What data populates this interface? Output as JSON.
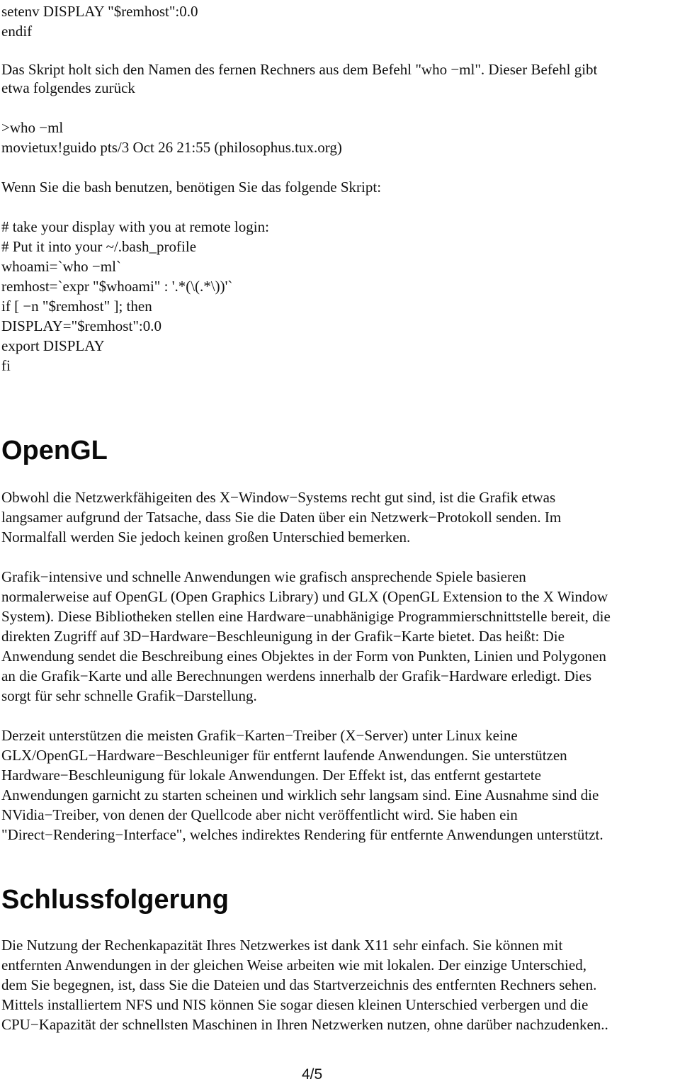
{
  "intro_code": [
    "setenv DISPLAY \"$remhost\":0.0",
    "endif"
  ],
  "intro_paragraph": [
    "Das Skript holt sich den Namen des fernen Rechners aus dem Befehl \"who −ml\". Dieser Befehl gibt",
    "etwa folgendes zurück"
  ],
  "who_output": [
    ">who −ml",
    "movietux!guido pts/3 Oct 26 21:55 (philosophus.tux.org)"
  ],
  "bash_intro": "Wenn Sie die bash benutzen, benötigen Sie das folgende Skript:",
  "bash_script": [
    "# take your display with you at remote login:",
    "# Put it into your ~/.bash_profile",
    "whoami=`who −ml`",
    "remhost=`expr \"$whoami\" : '.*(\\(.*\\))'`",
    "if [ −n \"$remhost\" ]; then",
    "DISPLAY=\"$remhost\":0.0",
    "export DISPLAY",
    "fi"
  ],
  "sections": [
    {
      "heading": "OpenGL",
      "paragraphs": [
        [
          "Obwohl die Netzwerkfähigeiten des X−Window−Systems recht gut sind, ist die Grafik etwas",
          "langsamer aufgrund der Tatsache, dass Sie die Daten über ein Netzwerk−Protokoll senden. Im",
          "Normalfall werden Sie jedoch keinen großen Unterschied bemerken."
        ],
        [
          "Grafik−intensive und schnelle Anwendungen wie grafisch ansprechende Spiele basieren",
          "normalerweise auf OpenGL (Open Graphics Library) und GLX (OpenGL Extension to the X Window",
          "System). Diese Bibliotheken stellen eine Hardware−unabhänigige Programmierschnittstelle bereit, die",
          "direkten Zugriff auf 3D−Hardware−Beschleunigung in der Grafik−Karte bietet. Das heißt: Die",
          "Anwendung sendet die Beschreibung eines Objektes in der Form von Punkten, Linien und Polygonen",
          "an die Grafik−Karte und alle Berechnungen werdens innerhalb der Grafik−Hardware erledigt. Dies",
          "sorgt für sehr schnelle Grafik−Darstellung."
        ],
        [
          "Derzeit unterstützen die meisten Grafik−Karten−Treiber (X−Server) unter Linux keine",
          "GLX/OpenGL−Hardware−Beschleuniger für entfernt laufende Anwendungen. Sie unterstützen",
          "Hardware−Beschleunigung für lokale Anwendungen. Der Effekt ist, das entfernt gestartete",
          "Anwendungen garnicht zu starten scheinen und wirklich sehr langsam sind. Eine Ausnahme sind die",
          "NVidia−Treiber, von denen der Quellcode aber nicht veröffentlicht wird. Sie haben ein",
          "\"Direct−Rendering−Interface\", welches indirektes Rendering für entfernte Anwendungen unterstützt."
        ]
      ]
    },
    {
      "heading": "Schlussfolgerung",
      "paragraphs": [
        [
          "Die Nutzung der Rechenkapazität Ihres Netzwerkes ist dank X11 sehr einfach. Sie können mit",
          "entfernten Anwendungen in der gleichen Weise arbeiten wie mit lokalen. Der einzige Unterschied,",
          "dem Sie begegnen, ist, dass Sie die Dateien und das Startverzeichnis des entfernten Rechners sehen.",
          "Mittels installiertem NFS und NIS können Sie sogar diesen kleinen Unterschied verbergen und die",
          "CPU−Kapazität der schnellsten Maschinen in Ihren Netzwerken nutzen, ohne darüber nachzudenken.."
        ]
      ]
    }
  ],
  "footer": {
    "page_number": "4/5"
  }
}
